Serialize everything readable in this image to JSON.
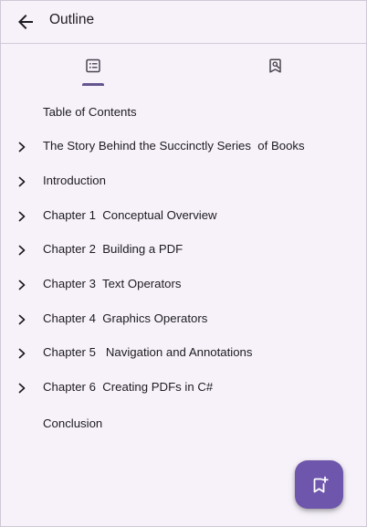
{
  "header": {
    "title": "Outline",
    "back_icon": "arrow-back-icon"
  },
  "tabs": [
    {
      "name": "outline",
      "icon": "list-icon",
      "selected": true
    },
    {
      "name": "bookmarks",
      "icon": "bookmark-search-icon",
      "selected": false
    }
  ],
  "toc": {
    "items": [
      {
        "label": "Table of Contents",
        "expandable": false
      },
      {
        "label": "The Story Behind the Succinctly Series  of Books",
        "expandable": true
      },
      {
        "label": "Introduction",
        "expandable": true
      },
      {
        "label": "Chapter 1  Conceptual Overview",
        "expandable": true
      },
      {
        "label": "Chapter 2  Building a PDF",
        "expandable": true
      },
      {
        "label": "Chapter 3  Text Operators",
        "expandable": true
      },
      {
        "label": "Chapter 4  Graphics Operators",
        "expandable": true
      },
      {
        "label": "Chapter 5   Navigation and Annotations",
        "expandable": true
      },
      {
        "label": "Chapter 6  Creating PDFs in C#",
        "expandable": true
      },
      {
        "label": "Conclusion",
        "expandable": false
      }
    ]
  },
  "fab": {
    "icon": "add-bookmark-icon"
  },
  "colors": {
    "accent": "#65558f",
    "fab": "#6e56ad",
    "background": "#f7f2fa",
    "text": "#1d1b20"
  }
}
